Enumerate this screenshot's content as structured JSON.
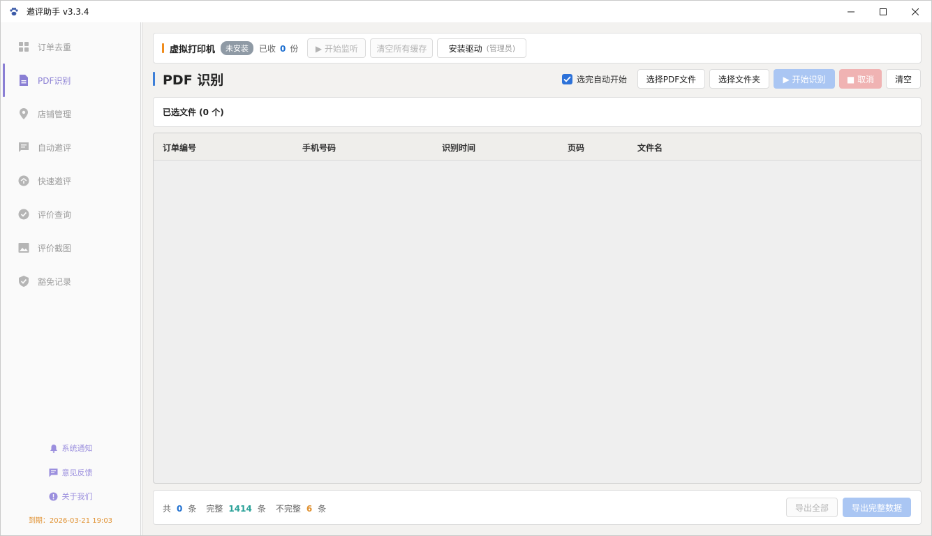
{
  "window": {
    "title": "邀评助手 v3.3.4"
  },
  "sidebar": {
    "items": [
      {
        "label": "订单去重",
        "icon": "grid-icon"
      },
      {
        "label": "PDF识别",
        "icon": "file-icon"
      },
      {
        "label": "店铺管理",
        "icon": "location-pin-icon"
      },
      {
        "label": "自动邀评",
        "icon": "message-icon"
      },
      {
        "label": "快速邀评",
        "icon": "speed-icon"
      },
      {
        "label": "评价查询",
        "icon": "check-circle-icon"
      },
      {
        "label": "评价截图",
        "icon": "image-icon"
      },
      {
        "label": "豁免记录",
        "icon": "shield-check-icon"
      }
    ],
    "active_index": 1,
    "footer": {
      "notify": "系统通知",
      "feedback": "意见反馈",
      "about": "关于我们",
      "expire": "到期：2026-03-21 19:03"
    }
  },
  "printer": {
    "title": "虚拟打印机",
    "badge": "未安装",
    "received_prefix": "已收",
    "received_count": "0",
    "received_suffix": "份",
    "start_monitor": "▶ 开始监听",
    "clear_cache": "清空所有缓存",
    "install_driver": "安装驱动",
    "install_driver_note": "(管理员)"
  },
  "page": {
    "title": "PDF 识别",
    "auto_start_label": "选完自动开始",
    "auto_start_checked": true,
    "select_pdf": "选择PDF文件",
    "select_folder": "选择文件夹",
    "start_recognize": "▶ 开始识别",
    "cancel": "■ 取消",
    "clear": "清空"
  },
  "files": {
    "label": "已选文件 (0 个)"
  },
  "table": {
    "columns": [
      "订单编号",
      "手机号码",
      "识别时间",
      "页码",
      "文件名"
    ],
    "rows": []
  },
  "footer": {
    "total_prefix": "共",
    "total": "0",
    "total_suffix": "条",
    "complete_prefix": "完整",
    "complete": "1414",
    "complete_suffix": "条",
    "incomplete_prefix": "不完整",
    "incomplete": "6",
    "incomplete_suffix": "条",
    "export_all": "导出全部",
    "export_complete": "导出完整数据"
  },
  "colors": {
    "accent": "#8a7fd4",
    "primary": "#2d72d9",
    "warning": "#f08c1c",
    "success": "#2aa198",
    "incomplete": "#e0902f"
  }
}
